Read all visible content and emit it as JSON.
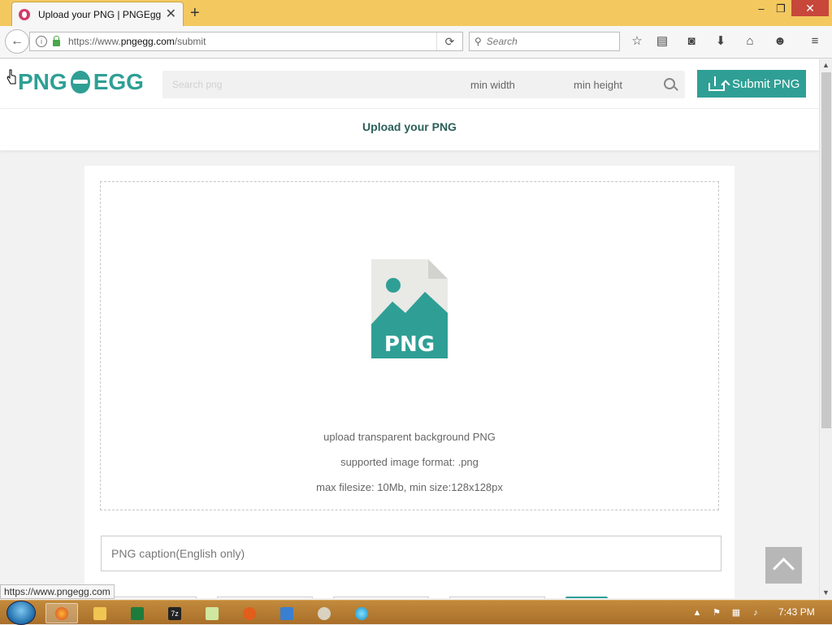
{
  "browser": {
    "tab_title": "Upload your PNG | PNGEgg",
    "url_prefix": "https://www.",
    "url_domain": "pngegg.com",
    "url_path": "/submit",
    "search_placeholder": "Search",
    "status_link": "https://www.pngegg.com"
  },
  "site": {
    "logo_left": "PNG",
    "logo_right": "EGG",
    "search_placeholder": "Search png",
    "min_width": "min width",
    "min_height": "min height",
    "submit_label": "Submit PNG",
    "brand_color": "#2f9f95"
  },
  "page": {
    "title": "Upload your PNG",
    "dropzone": {
      "icon_label": "PNG",
      "lines": [
        "upload transparent background PNG",
        "supported image format: .png",
        "max filesize: 10Mb, min size:128x128px"
      ]
    },
    "caption_placeholder": "PNG caption(English only)"
  },
  "taskbar": {
    "clock": "7:43 PM"
  }
}
